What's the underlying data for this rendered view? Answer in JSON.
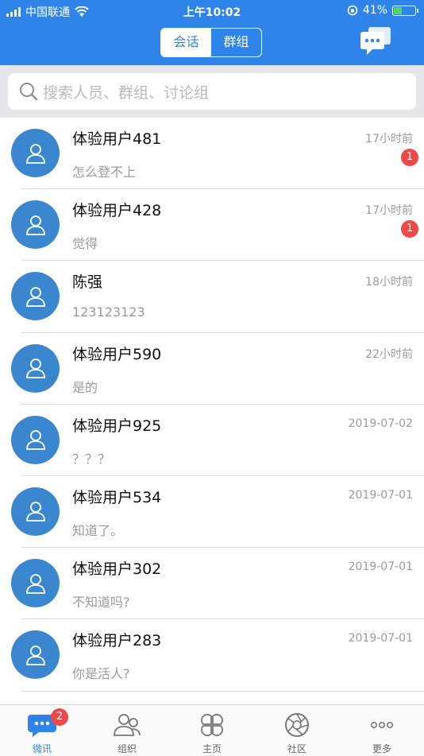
{
  "status_bar": {
    "carrier": "中国联通",
    "time": "上午10:02",
    "battery_percent": "41%",
    "battery_level": 0.41
  },
  "header": {
    "tabs": [
      {
        "label": "会话",
        "active": true
      },
      {
        "label": "群组",
        "active": false
      }
    ],
    "chat_icon": "chat-bubbles-icon"
  },
  "search": {
    "placeholder": "搜索人员、群组、讨论组"
  },
  "conversations": [
    {
      "name": "体验用户481",
      "message": "怎么登不上",
      "time": "17小时前",
      "unread": "1"
    },
    {
      "name": "体验用户428",
      "message": "觉得",
      "time": "17小时前",
      "unread": "1"
    },
    {
      "name": "陈强",
      "message": "123123123",
      "time": "18小时前",
      "unread": ""
    },
    {
      "name": "体验用户590",
      "message": "是的",
      "time": "22小时前",
      "unread": ""
    },
    {
      "name": "体验用户925",
      "message": "？？？",
      "time": "2019-07-02",
      "unread": ""
    },
    {
      "name": "体验用户534",
      "message": "知道了。",
      "time": "2019-07-01",
      "unread": ""
    },
    {
      "name": "体验用户302",
      "message": "不知道吗?",
      "time": "2019-07-01",
      "unread": ""
    },
    {
      "name": "体验用户283",
      "message": "你是活人?",
      "time": "2019-07-01",
      "unread": ""
    }
  ],
  "tabbar": {
    "items": [
      {
        "label": "微讯",
        "icon": "message-icon",
        "badge": "2",
        "active": true
      },
      {
        "label": "组织",
        "icon": "people-icon",
        "badge": "",
        "active": false
      },
      {
        "label": "主页",
        "icon": "clover-icon",
        "badge": "",
        "active": false
      },
      {
        "label": "社区",
        "icon": "aperture-icon",
        "badge": "",
        "active": false
      },
      {
        "label": "更多",
        "icon": "more-icon",
        "badge": "",
        "active": false
      }
    ]
  },
  "colors": {
    "primary": "#2f84ea",
    "avatar": "#3a86cf",
    "badge": "#f04747"
  }
}
